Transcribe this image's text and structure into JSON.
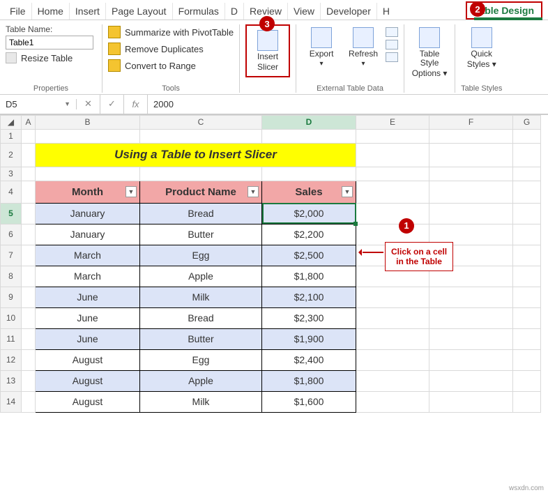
{
  "ribbon": {
    "tabs": [
      "File",
      "Home",
      "Insert",
      "Page Layout",
      "Formulas",
      "D",
      "Review",
      "View",
      "Developer",
      "H"
    ],
    "tableDesign": "Table Design"
  },
  "badges": {
    "b1": "1",
    "b2": "2",
    "b3": "3"
  },
  "properties": {
    "tableNameLabel": "Table Name:",
    "tableNameValue": "Table1",
    "resize": "Resize Table",
    "groupLabel": "Properties"
  },
  "tools": {
    "pivot": "Summarize with PivotTable",
    "remove": "Remove Duplicates",
    "convert": "Convert to Range",
    "groupLabel": "Tools"
  },
  "insertSlicer": {
    "l1": "Insert",
    "l2": "Slicer"
  },
  "external": {
    "export": "Export",
    "refresh": "Refresh",
    "groupLabel": "External Table Data"
  },
  "styleOpts": {
    "l1": "Table Style",
    "l2": "Options"
  },
  "quickStyles": {
    "l1": "Quick",
    "l2": "Styles",
    "groupLabel": "Table Styles"
  },
  "fx": {
    "namebox": "D5",
    "fxlabel": "fx",
    "value": "2000"
  },
  "cols": [
    "A",
    "B",
    "C",
    "D",
    "E",
    "F",
    "G"
  ],
  "rows": [
    "1",
    "2",
    "3",
    "4",
    "5",
    "6",
    "7",
    "8",
    "9",
    "10",
    "11",
    "12",
    "13",
    "14"
  ],
  "banner": "Using a Table to Insert Slicer",
  "headers": {
    "month": "Month",
    "product": "Product Name",
    "sales": "Sales"
  },
  "chart_data": {
    "type": "table",
    "columns": [
      "Month",
      "Product Name",
      "Sales"
    ],
    "rows": [
      [
        "January",
        "Bread",
        "$2,000"
      ],
      [
        "January",
        "Butter",
        "$2,200"
      ],
      [
        "March",
        "Egg",
        "$2,500"
      ],
      [
        "March",
        "Apple",
        "$1,800"
      ],
      [
        "June",
        "Milk",
        "$2,100"
      ],
      [
        "June",
        "Bread",
        "$2,300"
      ],
      [
        "June",
        "Butter",
        "$1,900"
      ],
      [
        "August",
        "Egg",
        "$2,400"
      ],
      [
        "August",
        "Apple",
        "$1,800"
      ],
      [
        "August",
        "Milk",
        "$1,600"
      ]
    ]
  },
  "callout": {
    "l1": "Click on a cell",
    "l2": "in the Table"
  },
  "watermark": "wsxdn.com"
}
